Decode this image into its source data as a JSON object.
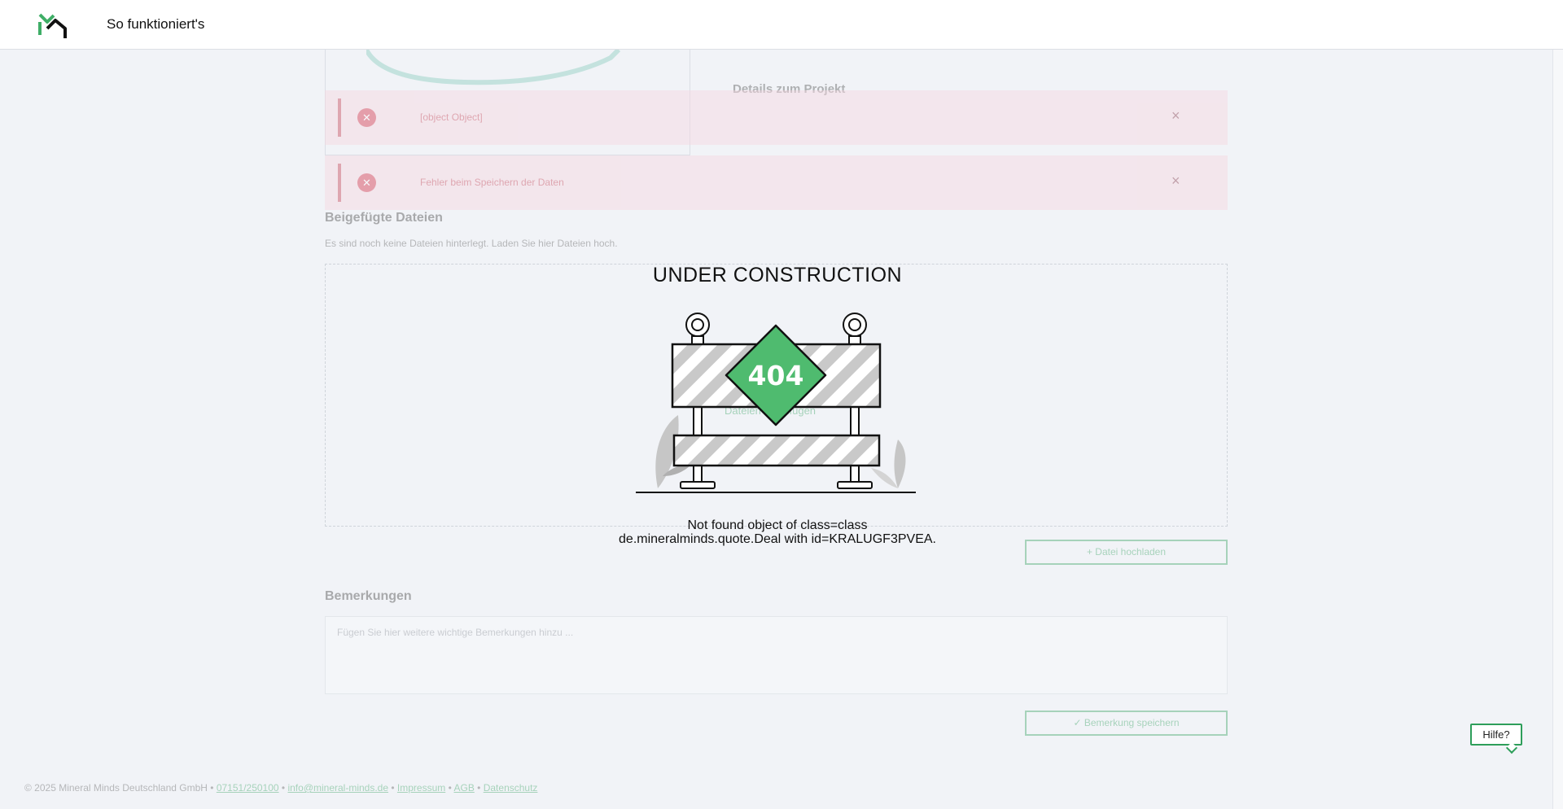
{
  "header": {
    "nav_label": "So funktioniert's"
  },
  "project": {
    "details_title": "Details zum Projekt"
  },
  "errors": [
    {
      "message": "[object Object]",
      "close": "×"
    },
    {
      "message": "Fehler beim Speichern der Daten",
      "close": "×"
    }
  ],
  "attachments": {
    "title": "Beigefügte Dateien",
    "subtitle": "Es sind noch keine Dateien hinterlegt. Laden Sie hier Dateien hoch.",
    "dropzone_label": "Dateien hinzufügen",
    "upload_button": "+ Datei hochladen"
  },
  "remarks": {
    "title": "Bemerkungen",
    "placeholder": "Fügen Sie hier weitere wichtige Bemerkungen hinzu ...",
    "save_button": "✓ Bemerkung speichern"
  },
  "overlay": {
    "title": "UNDER CONSTRUCTION",
    "code": "404",
    "message_line1": "Not found object of class=class",
    "message_line2": "de.mineralminds.quote.Deal with id=KRALUGF3PVEA."
  },
  "footer": {
    "copyright": "© 2025 Mineral Minds Deutschland GmbH •",
    "phone": "07151/250100",
    "email": "info@mineral-minds.de",
    "impressum": "Impressum",
    "agb": "AGB",
    "datenschutz": "Datenschutz",
    "sep": "•"
  },
  "help": {
    "label": "Hilfe?"
  },
  "colors": {
    "accent": "#2e9e5a",
    "error": "#d5384e",
    "background": "#f1f3f7"
  }
}
